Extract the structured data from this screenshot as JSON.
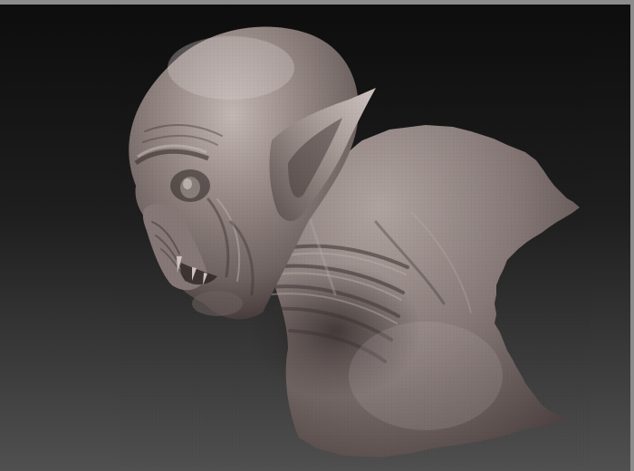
{
  "viewport": {
    "background_top": "#0d0d0d",
    "background_bottom": "#505050",
    "frame_color": "#8c8c8c"
  },
  "model": {
    "material_color": "#7d706e",
    "highlight_color": "#c4b8b5",
    "shadow_color": "#2c2423"
  }
}
